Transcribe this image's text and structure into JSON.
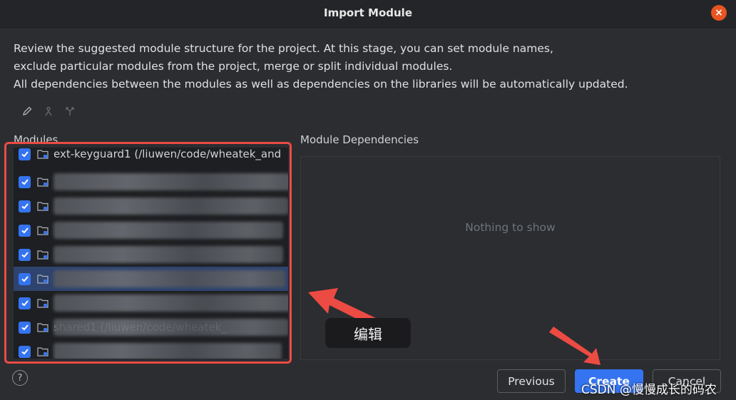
{
  "window": {
    "title": "Import Module",
    "close_symbol": "×"
  },
  "description": [
    "Review the suggested module structure for the project. At this stage, you can set module names,",
    "exclude particular modules from the project, merge or split individual modules.",
    "All dependencies between the modules as well as dependencies on the libraries will be automatically updated."
  ],
  "toolbar": {
    "icons": [
      "edit-icon",
      "person-icon",
      "split-icon"
    ]
  },
  "modules": {
    "label": "Modules",
    "rows": [
      {
        "checked": true,
        "text": "ext-keyguard1 (/liuwen/code/wheatek_and",
        "obscured": false,
        "selected": false
      },
      {
        "checked": true,
        "text": "",
        "obscured": true,
        "selected": false
      },
      {
        "checked": true,
        "text": "",
        "obscured": true,
        "selected": false
      },
      {
        "checked": true,
        "text": "",
        "obscured": true,
        "selected": false
      },
      {
        "checked": true,
        "text": "",
        "obscured": true,
        "selected": false
      },
      {
        "checked": true,
        "text": "",
        "obscured": true,
        "selected": true
      },
      {
        "checked": true,
        "text": "",
        "obscured": true,
        "selected": false
      },
      {
        "checked": true,
        "text": "shared1 (/liuwen/code/wheatek_",
        "obscured": true,
        "selected": false
      },
      {
        "checked": true,
        "text": "",
        "obscured": true,
        "selected": false
      }
    ]
  },
  "dependencies": {
    "label": "Module Dependencies",
    "empty_text": "Nothing to show"
  },
  "footer": {
    "help_label": "?",
    "previous_label": "Previous",
    "create_label": "Create",
    "cancel_label": "Cancel"
  },
  "annotation": {
    "callout_text": "编辑",
    "watermark": "CSDN @慢慢成长的码农"
  },
  "colors": {
    "accent": "#3574f0",
    "annotation_red": "#ec4b43",
    "close": "#e95420"
  }
}
